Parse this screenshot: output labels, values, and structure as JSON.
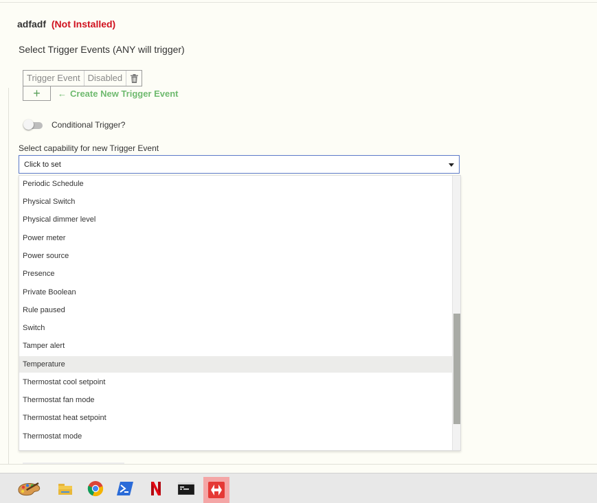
{
  "app": {
    "name": "adfadf",
    "status": "(Not Installed)"
  },
  "section_title": "Select Trigger Events (ANY will trigger)",
  "trigger_table": {
    "columns": [
      "Trigger Event",
      "Disabled"
    ]
  },
  "add_button": {
    "label": "+"
  },
  "create_link": {
    "arrow": "←",
    "label": "Create New Trigger Event"
  },
  "conditional": {
    "label": "Conditional Trigger?",
    "enabled": false
  },
  "capability": {
    "label": "Select capability for new Trigger Event",
    "value": "Click to set",
    "options": [
      "Periodic Schedule",
      "Physical Switch",
      "Physical dimmer level",
      "Power meter",
      "Power source",
      "Presence",
      "Private Boolean",
      "Rule paused",
      "Switch",
      "Tamper alert",
      "Temperature",
      "Thermostat cool setpoint",
      "Thermostat fan mode",
      "Thermostat heat setpoint",
      "Thermostat mode"
    ],
    "highlighted": "Temperature"
  },
  "taskbar": {
    "apps": [
      "paint-palette-icon",
      "file-explorer-icon",
      "chrome-icon",
      "powershell-icon",
      "netflix-icon",
      "terminal-icon",
      "remote-desktop-icon"
    ],
    "active": "remote-desktop-icon"
  },
  "colors": {
    "status_red": "#d0101e",
    "link_green": "#6fba6f",
    "select_border": "#5a78c8",
    "background": "#fdfdf6",
    "active_app": "#f4a6a6"
  }
}
